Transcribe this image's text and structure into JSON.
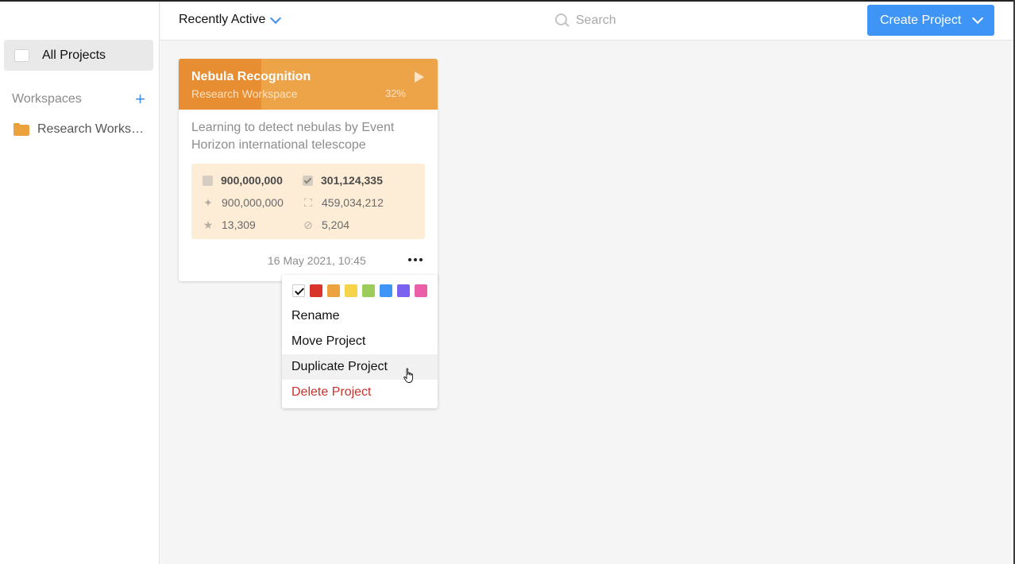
{
  "sidebar": {
    "all_projects_label": "All Projects",
    "workspaces_label": "Workspaces",
    "workspaces": [
      {
        "label": "Research Workspace"
      }
    ]
  },
  "header": {
    "sort_label": "Recently Active",
    "search_placeholder": "Search",
    "create_label": "Create Project"
  },
  "project": {
    "title": "Nebula Recognition",
    "workspace": "Research Workspace",
    "progress_label": "32%",
    "progress": 0.32,
    "description": "Learning to detect nebulas by Event Horizon international telescope",
    "stats": {
      "total": "900,000,000",
      "done": "301,124,335",
      "predicted": "900,000,000",
      "annotations": "459,034,212",
      "starred": "13,309",
      "skipped": "5,204"
    },
    "date": "16 May 2021, 10:45"
  },
  "menu": {
    "swatches": [
      "#d9342b",
      "#eda33d",
      "#f5d44a",
      "#9ccd5a",
      "#3f95f5",
      "#7b61f0",
      "#ea5fa7"
    ],
    "items": [
      "Rename",
      "Move Project",
      "Duplicate Project",
      "Delete Project"
    ]
  },
  "colors": {
    "accent": "#3f95f5",
    "card_header": "#eda448",
    "danger": "#c8322b"
  }
}
